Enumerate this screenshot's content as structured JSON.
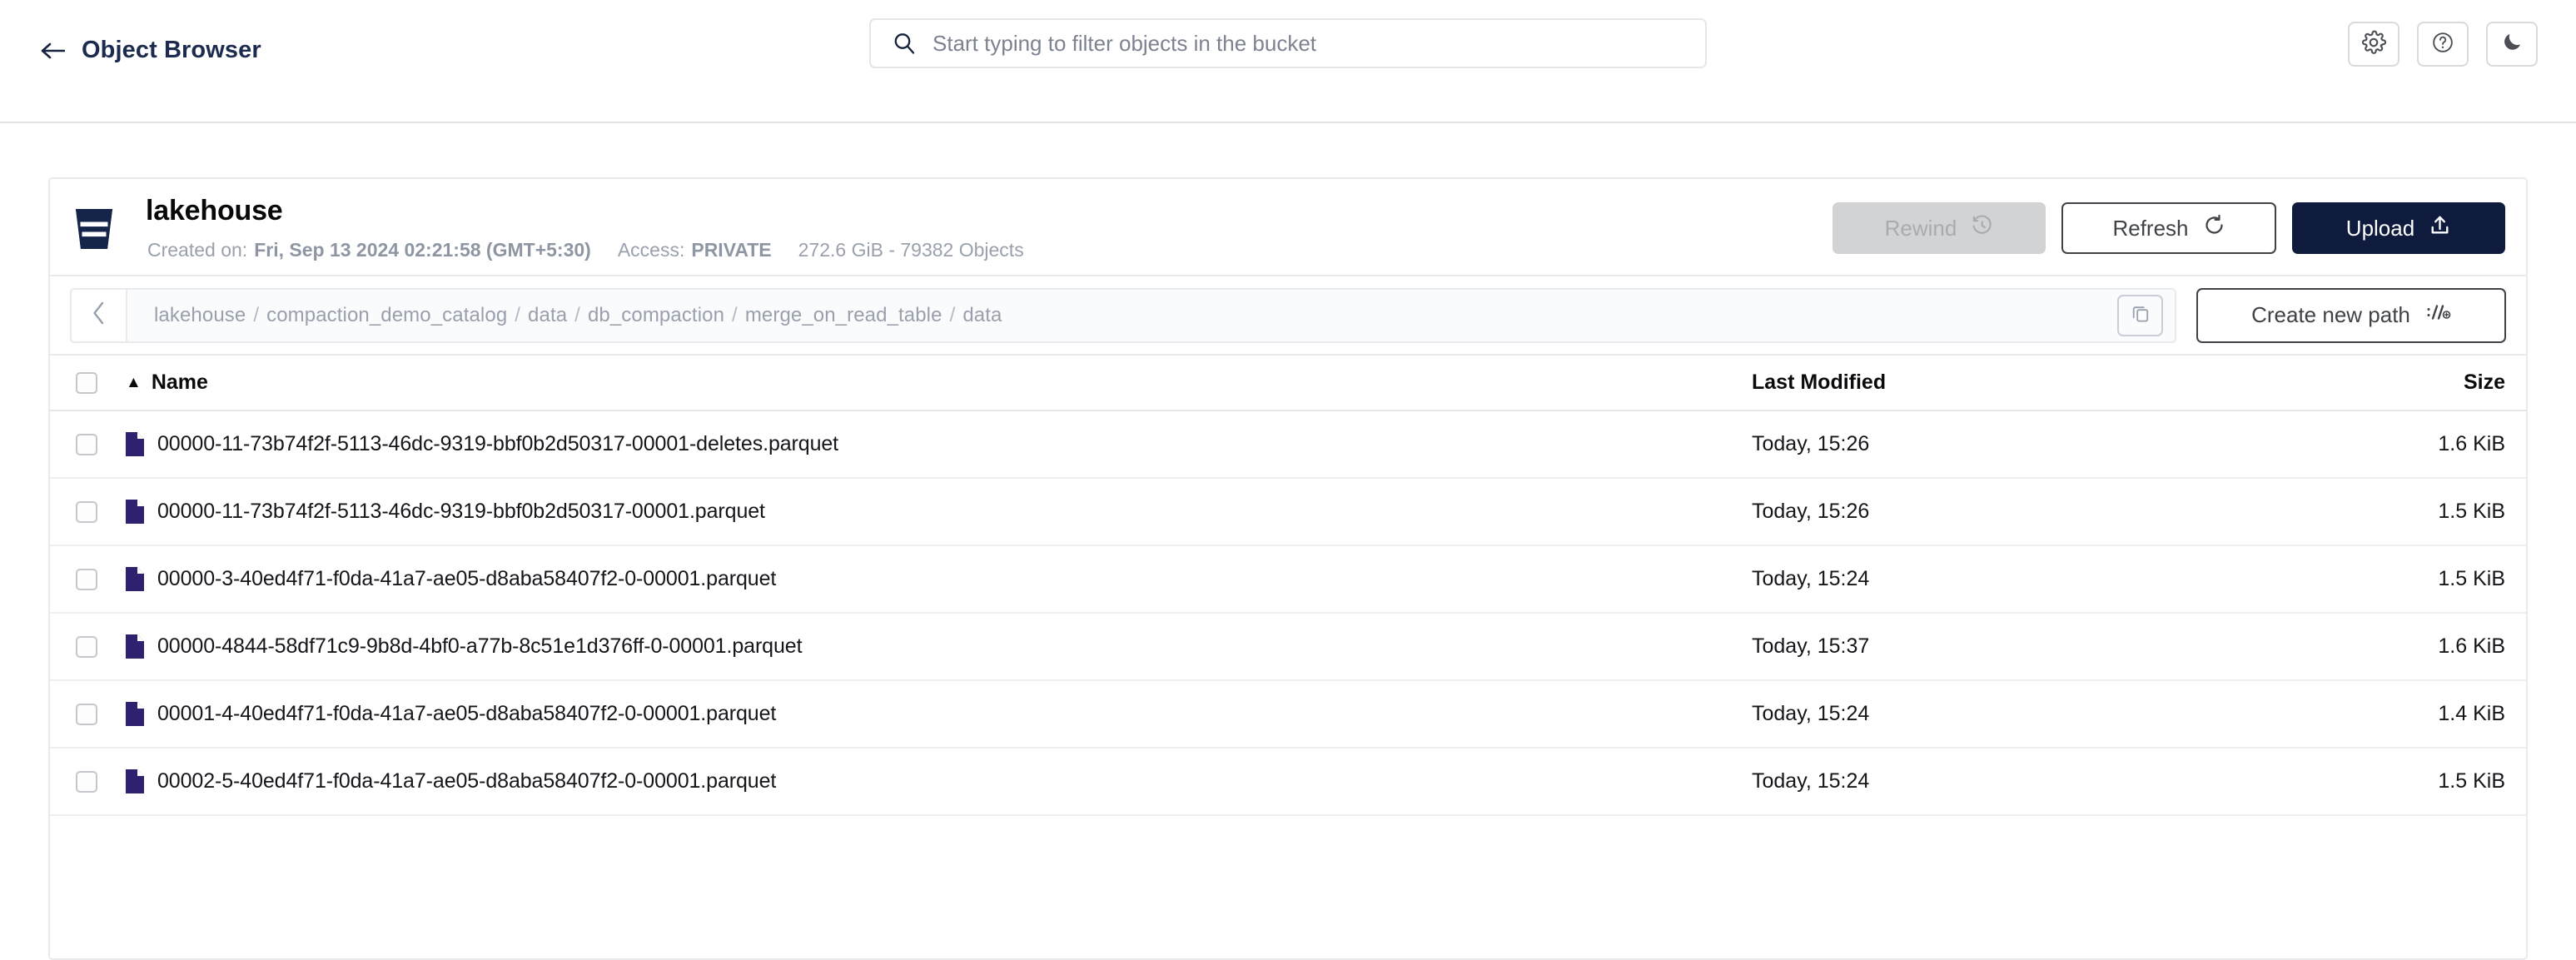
{
  "topbar": {
    "back_label": "Object Browser",
    "back_icon": "arrow-left-icon",
    "search": {
      "placeholder": "Start typing to filter objects in the bucket",
      "value": "",
      "icon": "search-icon"
    },
    "actions": [
      {
        "name": "settings",
        "icon": "gear-icon"
      },
      {
        "name": "help",
        "icon": "question-circle-icon"
      },
      {
        "name": "dark-mode",
        "icon": "moon-icon"
      }
    ]
  },
  "bucket": {
    "icon": "bucket-icon",
    "name": "lakehouse",
    "created_label": "Created on:",
    "created_value": "Fri, Sep 13 2024 02:21:58 (GMT+5:30)",
    "access_label": "Access:",
    "access_value": "PRIVATE",
    "usage": "272.6 GiB - 79382 Objects",
    "actions": {
      "rewind": {
        "label": "Rewind",
        "icon": "rewind-clock-icon",
        "disabled": true
      },
      "refresh": {
        "label": "Refresh",
        "icon": "refresh-icon"
      },
      "upload": {
        "label": "Upload",
        "icon": "upload-icon"
      }
    }
  },
  "breadcrumb": {
    "back_icon": "chevron-left-icon",
    "segments": [
      "lakehouse",
      "compaction_demo_catalog",
      "data",
      "db_compaction",
      "merge_on_read_table",
      "data"
    ],
    "separator": "/",
    "copy_icon": "copy-icon",
    "create_path": {
      "label": "Create new path",
      "icon": "path-slash-icon"
    }
  },
  "table": {
    "columns": {
      "name": "Name",
      "last_modified": "Last Modified",
      "size": "Size"
    },
    "sort": {
      "column": "Name",
      "direction": "asc",
      "caret": "▲"
    },
    "rows": [
      {
        "icon": "parquet-file-icon",
        "name": "00000-11-73b74f2f-5113-46dc-9319-bbf0b2d50317-00001-deletes.parquet",
        "last_modified": "Today, 15:26",
        "size": "1.6 KiB"
      },
      {
        "icon": "parquet-file-icon",
        "name": "00000-11-73b74f2f-5113-46dc-9319-bbf0b2d50317-00001.parquet",
        "last_modified": "Today, 15:26",
        "size": "1.5 KiB"
      },
      {
        "icon": "parquet-file-icon",
        "name": "00000-3-40ed4f71-f0da-41a7-ae05-d8aba58407f2-0-00001.parquet",
        "last_modified": "Today, 15:24",
        "size": "1.5 KiB"
      },
      {
        "icon": "parquet-file-icon",
        "name": "00000-4844-58df71c9-9b8d-4bf0-a77b-8c51e1d376ff-0-00001.parquet",
        "last_modified": "Today, 15:37",
        "size": "1.6 KiB"
      },
      {
        "icon": "parquet-file-icon",
        "name": "00001-4-40ed4f71-f0da-41a7-ae05-d8aba58407f2-0-00001.parquet",
        "last_modified": "Today, 15:24",
        "size": "1.4 KiB"
      },
      {
        "icon": "parquet-file-icon",
        "name": "00002-5-40ed4f71-f0da-41a7-ae05-d8aba58407f2-0-00001.parquet",
        "last_modified": "Today, 15:24",
        "size": "1.5 KiB"
      }
    ]
  },
  "colors": {
    "brand_navy": "#0e1b3d",
    "file_icon_purple": "#2f2070",
    "border": "#e8eaed",
    "muted_text": "#9aa1ad"
  }
}
